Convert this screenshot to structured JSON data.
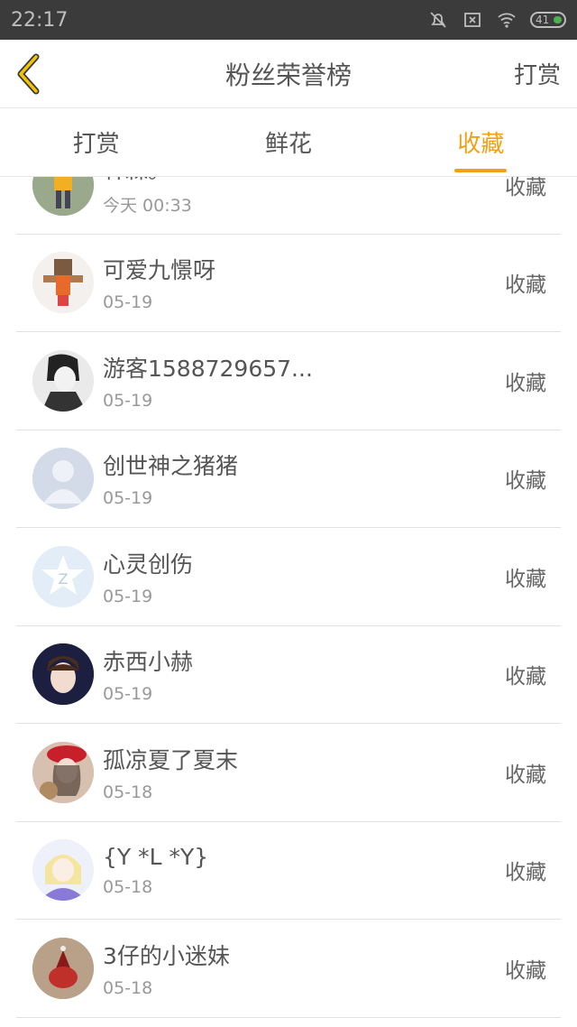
{
  "status": {
    "time": "22:17",
    "battery": "41"
  },
  "header": {
    "title": "粉丝荣誉榜",
    "right_action": "打赏"
  },
  "tabs": [
    {
      "label": "打赏"
    },
    {
      "label": "鲜花"
    },
    {
      "label": "收藏"
    }
  ],
  "rows": [
    {
      "name": "林森。",
      "date": "今天 00:33",
      "action": "收藏"
    },
    {
      "name": "可爱九憬呀",
      "date": "05-19",
      "action": "收藏"
    },
    {
      "name": "游客1588729657...",
      "date": "05-19",
      "action": "收藏"
    },
    {
      "name": "创世神之猪猪",
      "date": "05-19",
      "action": "收藏"
    },
    {
      "name": "心灵创伤",
      "date": "05-19",
      "action": "收藏"
    },
    {
      "name": "赤西小赫",
      "date": "05-19",
      "action": "收藏"
    },
    {
      "name": "孤凉夏了夏末",
      "date": "05-18",
      "action": "收藏"
    },
    {
      "name": "{Y *L *Y}",
      "date": "05-18",
      "action": "收藏"
    },
    {
      "name": "3仔的小迷妹",
      "date": "05-18",
      "action": "收藏"
    }
  ],
  "colors": {
    "accent": "#f0a216",
    "statusbar": "#3b3b3b"
  }
}
